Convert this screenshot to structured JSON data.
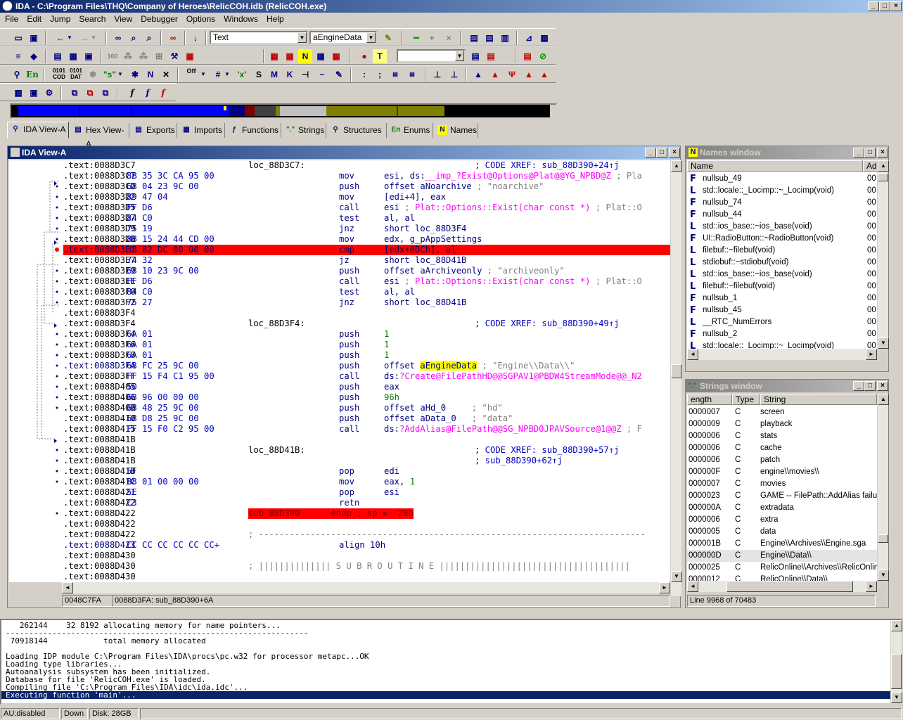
{
  "app": {
    "title": "IDA - C:\\Program Files\\THQ\\Company of Heroes\\RelicCOH.idb (RelicCOH.exe)"
  },
  "menu": [
    "File",
    "Edit",
    "Jump",
    "Search",
    "View",
    "Debugger",
    "Options",
    "Windows",
    "Help"
  ],
  "toolbar": {
    "text_mode": "Text",
    "name_combo": "aEngineData",
    "empty_combo": ""
  },
  "tabs": [
    {
      "label": "IDA View-A",
      "icon": "ida-view-icon"
    },
    {
      "label": "Hex View-A",
      "icon": "hex-view-icon"
    },
    {
      "label": "Exports",
      "icon": "exports-icon"
    },
    {
      "label": "Imports",
      "icon": "imports-icon"
    },
    {
      "label": "Functions",
      "icon": "functions-icon"
    },
    {
      "label": "Strings",
      "icon": "strings-icon"
    },
    {
      "label": "Structures",
      "icon": "structures-icon"
    },
    {
      "label": "Enums",
      "icon": "enums-icon"
    },
    {
      "label": "Names",
      "icon": "names-icon"
    }
  ],
  "ida_view": {
    "title": "IDA View-A",
    "status_left": "0048C7FA",
    "status_right": "0088D3FA: sub_88D390+6A",
    "lines": [
      {
        "addr": ".text:0088D3C7",
        "bytes": "",
        "label": "loc_88D3C7:",
        "mnem": "",
        "op": "",
        "cmt": "; CODE XREF: sub_88D390+24↑j"
      },
      {
        "addr": ".text:0088D3C7",
        "bytes": "8B 35 3C CA 95 00",
        "label": "",
        "mnem": "mov",
        "op": "esi, ds:",
        "op_pink": "__imp_?Exist@Options@Plat@@YG_NPBD@Z",
        "cmt2": " ; Pla"
      },
      {
        "addr": ".text:0088D3CD",
        "bytes": "68 04 23 9C 00",
        "label": "",
        "mnem": "push",
        "op": "offset aNoarchive",
        "cmt2": " ; \"noarchive\""
      },
      {
        "addr": ".text:0088D3D2",
        "bytes": "89 47 04",
        "label": "",
        "mnem": "mov",
        "op": "[edi+4], eax"
      },
      {
        "addr": ".text:0088D3D5",
        "bytes": "FF D6",
        "label": "",
        "mnem": "call",
        "op": "esi",
        "cmt2": " ; ",
        "op_pink2": "Plat::Options::Exist(char const *)",
        "cmt3": " ; Plat::O"
      },
      {
        "addr": ".text:0088D3D7",
        "bytes": "84 C0",
        "label": "",
        "mnem": "test",
        "op": "al, al"
      },
      {
        "addr": ".text:0088D3D9",
        "bytes": "75 19",
        "label": "",
        "mnem": "jnz",
        "op": "short loc_88D3F4"
      },
      {
        "addr": ".text:0088D3DB",
        "bytes": "8B 15 24 44 CD 00",
        "label": "",
        "mnem": "mov",
        "op": "edx, g_pAppSettings"
      },
      {
        "addr": ".text:0088D3E1",
        "bytes": "38 82 DC 00 00 00",
        "label": "",
        "mnem": "cmp",
        "op": "[edx+0DCh], al",
        "hl": true
      },
      {
        "addr": ".text:0088D3E7",
        "bytes": "74 32",
        "label": "",
        "mnem": "jz",
        "op": "short loc_88D41B"
      },
      {
        "addr": ".text:0088D3E9",
        "bytes": "68 10 23 9C 00",
        "label": "",
        "mnem": "push",
        "op": "offset aArchiveonly",
        "cmt2": " ; \"archiveonly\""
      },
      {
        "addr": ".text:0088D3EE",
        "bytes": "FF D6",
        "label": "",
        "mnem": "call",
        "op": "esi",
        "cmt2": " ; ",
        "op_pink2": "Plat::Options::Exist(char const *)",
        "cmt3": " ; Plat::O"
      },
      {
        "addr": ".text:0088D3F0",
        "bytes": "84 C0",
        "label": "",
        "mnem": "test",
        "op": "al, al"
      },
      {
        "addr": ".text:0088D3F2",
        "bytes": "75 27",
        "label": "",
        "mnem": "jnz",
        "op": "short loc_88D41B"
      },
      {
        "addr": ".text:0088D3F4",
        "bytes": "",
        "label": "",
        "mnem": "",
        "op": ""
      },
      {
        "addr": ".text:0088D3F4",
        "bytes": "",
        "label": "loc_88D3F4:",
        "mnem": "",
        "op": "",
        "cmt": "; CODE XREF: sub_88D390+49↑j"
      },
      {
        "addr": ".text:0088D3F4",
        "bytes": "6A 01",
        "label": "",
        "mnem": "push",
        "op": "",
        "op_grn": "1"
      },
      {
        "addr": ".text:0088D3F6",
        "bytes": "6A 01",
        "label": "",
        "mnem": "push",
        "op": "",
        "op_grn": "1"
      },
      {
        "addr": ".text:0088D3F8",
        "bytes": "6A 01",
        "label": "",
        "mnem": "push",
        "op": "",
        "op_grn": "1"
      },
      {
        "addr": ".text:0088D3FA",
        "bytes": "68 FC 25 9C 00",
        "label": "",
        "mnem": "push",
        "op": "offset ",
        "op_yel": "aEngineData",
        "cmt2": " ; \"Engine\\\\Data\\\\\"",
        "blueaddr": true
      },
      {
        "addr": ".text:0088D3FF",
        "bytes": "FF 15 F4 C1 95 00",
        "label": "",
        "mnem": "call",
        "op": "ds:",
        "op_pink": "?Create@FilePathHD@@SGPAV1@PBDW4StreamMode@@_N2"
      },
      {
        "addr": ".text:0088D405",
        "bytes": "50",
        "label": "",
        "mnem": "push",
        "op": "eax"
      },
      {
        "addr": ".text:0088D406",
        "bytes": "68 96 00 00 00",
        "label": "",
        "mnem": "push",
        "op": "",
        "op_grn": "96h"
      },
      {
        "addr": ".text:0088D40B",
        "bytes": "68 48 25 9C 00",
        "label": "",
        "mnem": "push",
        "op": "offset aHd_0",
        "cmt2": "     ; \"hd\""
      },
      {
        "addr": ".text:0088D410",
        "bytes": "68 D8 25 9C 00",
        "label": "",
        "mnem": "push",
        "op": "offset aData_0",
        "cmt2": "   ; \"data\""
      },
      {
        "addr": ".text:0088D415",
        "bytes": "FF 15 F0 C2 95 00",
        "label": "",
        "mnem": "call",
        "op": "ds:",
        "op_pink": "?AddAlias@FilePath@@SG_NPBD0JPAVSource@1@@Z",
        "cmt2": " ; F"
      },
      {
        "addr": ".text:0088D41B",
        "bytes": "",
        "label": "",
        "mnem": "",
        "op": ""
      },
      {
        "addr": ".text:0088D41B",
        "bytes": "",
        "label": "loc_88D41B:",
        "mnem": "",
        "op": "",
        "cmt": "; CODE XREF: sub_88D390+57↑j"
      },
      {
        "addr": ".text:0088D41B",
        "bytes": "",
        "label": "",
        "mnem": "",
        "op": "",
        "cmt": "; sub_88D390+62↑j"
      },
      {
        "addr": ".text:0088D41B",
        "bytes": "5F",
        "label": "",
        "mnem": "pop",
        "op": "edi"
      },
      {
        "addr": ".text:0088D41C",
        "bytes": "B8 01 00 00 00",
        "label": "",
        "mnem": "mov",
        "op": "eax, ",
        "op_grn": "1"
      },
      {
        "addr": ".text:0088D421",
        "bytes": "5E",
        "label": "",
        "mnem": "pop",
        "op": "esi"
      },
      {
        "addr": ".text:0088D422",
        "bytes": "C3",
        "label": "",
        "mnem": "retn",
        "op": ""
      },
      {
        "addr": ".text:0088D422",
        "bytes": "",
        "label": "sub_88D390",
        "mnem": "endp ; sp =  28h",
        "op": "",
        "endp": true
      },
      {
        "addr": ".text:0088D422",
        "bytes": "",
        "label": "",
        "mnem": "",
        "op": ""
      },
      {
        "addr": ".text:0088D422",
        "bytes": "",
        "label": "",
        "mnem": "",
        "op": "",
        "dashes": "; ---------------------------------------------------------------------------"
      },
      {
        "addr": ".text:0088D423",
        "bytes": "CC CC CC CC CC CC+",
        "label": "",
        "mnem": "align 10h",
        "op": "",
        "blueaddr": true
      },
      {
        "addr": ".text:0088D430",
        "bytes": "",
        "label": "",
        "mnem": "",
        "op": ""
      },
      {
        "addr": ".text:0088D430",
        "bytes": "",
        "label": "",
        "mnem": "",
        "op": "",
        "dashes": "; |||||||||||||| S U B R O U T I N E |||||||||||||||||||||||||||||||||||||"
      },
      {
        "addr": ".text:0088D430",
        "bytes": "",
        "label": "",
        "mnem": "",
        "op": ""
      }
    ]
  },
  "names_window": {
    "title": "Names window",
    "col_name": "Name",
    "col_addr": "Ad",
    "rows": [
      {
        "icon": "F",
        "name": "nullsub_49",
        "addr": "00"
      },
      {
        "icon": "L",
        "name": "std::locale::_Locimp::~_Locimp(void)",
        "addr": "00"
      },
      {
        "icon": "F",
        "name": "nullsub_74",
        "addr": "00"
      },
      {
        "icon": "F",
        "name": "nullsub_44",
        "addr": "00"
      },
      {
        "icon": "L",
        "name": "std::ios_base::~ios_base(void)",
        "addr": "00"
      },
      {
        "icon": "F",
        "name": "UI::RadioButton::~RadioButton(void)",
        "addr": "00"
      },
      {
        "icon": "L",
        "name": "filebuf::~filebuf(void)",
        "addr": "00"
      },
      {
        "icon": "L",
        "name": "stdiobuf::~stdiobuf(void)",
        "addr": "00"
      },
      {
        "icon": "L",
        "name": "std::ios_base::~ios_base(void)",
        "addr": "00"
      },
      {
        "icon": "L",
        "name": "filebuf::~filebuf(void)",
        "addr": "00"
      },
      {
        "icon": "F",
        "name": "nullsub_1",
        "addr": "00"
      },
      {
        "icon": "F",
        "name": "nullsub_45",
        "addr": "00"
      },
      {
        "icon": "L",
        "name": "__RTC_NumErrors",
        "addr": "00"
      },
      {
        "icon": "F",
        "name": "nullsub_2",
        "addr": "00"
      },
      {
        "icon": "L",
        "name": "std::locale::_Locimp::~_Locimp(void)",
        "addr": "00"
      }
    ]
  },
  "strings_window": {
    "title": "Strings window",
    "col_len": "ength",
    "col_type": "Type",
    "col_string": "String",
    "status": "Line 9968 of 70483",
    "rows": [
      {
        "len": "0000007",
        "type": "C",
        "str": "screen"
      },
      {
        "len": "0000009",
        "type": "C",
        "str": "playback"
      },
      {
        "len": "0000006",
        "type": "C",
        "str": "stats"
      },
      {
        "len": "0000006",
        "type": "C",
        "str": "cache"
      },
      {
        "len": "0000006",
        "type": "C",
        "str": "patch"
      },
      {
        "len": "000000F",
        "type": "C",
        "str": "engine\\\\movies\\\\"
      },
      {
        "len": "0000007",
        "type": "C",
        "str": "movies"
      },
      {
        "len": "0000023",
        "type": "C",
        "str": "GAME -- FilePath::AddAlias failure"
      },
      {
        "len": "000000A",
        "type": "C",
        "str": "extradata"
      },
      {
        "len": "0000006",
        "type": "C",
        "str": "extra"
      },
      {
        "len": "0000005",
        "type": "C",
        "str": "data"
      },
      {
        "len": "000001B",
        "type": "C",
        "str": "Engine\\\\Archives\\\\Engine.sga"
      },
      {
        "len": "000000D",
        "type": "C",
        "str": "Engine\\\\Data\\\\",
        "sel": true
      },
      {
        "len": "0000025",
        "type": "C",
        "str": "RelicOnline\\\\Archives\\\\RelicOnline"
      },
      {
        "len": "0000012",
        "type": "C",
        "str": "RelicOnline\\\\Data\\\\"
      }
    ]
  },
  "output": {
    "lines": [
      "   262144    32 8192 allocating memory for name pointers...",
      "-----------------------------------------------------------------",
      " 70918144            total memory allocated",
      "",
      "Loading IDP module C:\\Program Files\\IDA\\procs\\pc.w32 for processor metapc...OK",
      "Loading type libraries...",
      "Autoanalysis subsystem has been initialized.",
      "Database for file 'RelicCOH.exe' is loaded.",
      "Compiling file 'C:\\Program Files\\IDA\\idc\\ida.idc'...",
      "Executing function 'main'..."
    ]
  },
  "statusbar": {
    "au": "AU:disabled",
    "dir": "Down",
    "disk": "Disk: 28GB"
  }
}
